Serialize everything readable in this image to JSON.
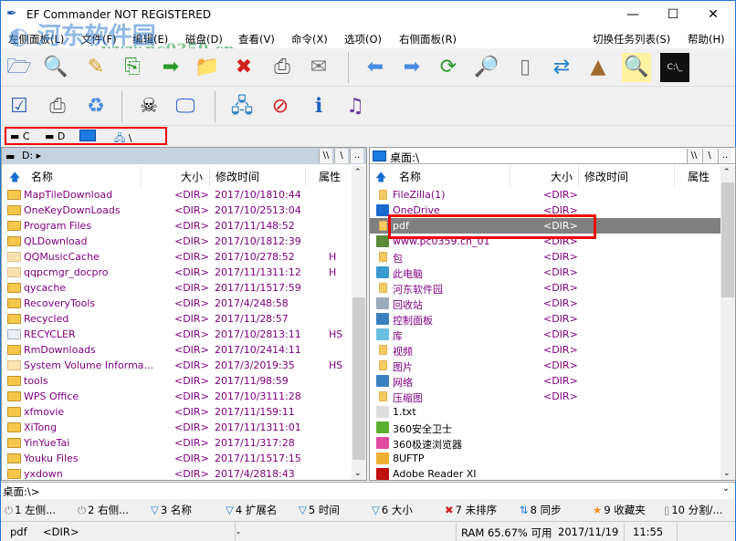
{
  "window": {
    "title": "EF Commander NOT REGISTERED",
    "minimize": "—",
    "maximize": "☐",
    "close": "✕"
  },
  "watermark": {
    "name": "河东软件园",
    "url": "www.pc0359.cn"
  },
  "menu": [
    "左侧面板(L)",
    "文件(F)",
    "编辑(E)",
    "磁盘(D)",
    "查看(V)",
    "命令(X)",
    "选项(O)",
    "右侧面板(R)",
    "切换任务列表(S)",
    "帮助(H)"
  ],
  "drives": {
    "c": "C",
    "d": "D",
    "net": "\\"
  },
  "left": {
    "path": "D: ▸",
    "btns": [
      "\\\\",
      "\\",
      ".."
    ],
    "columns": {
      "name": "名称",
      "size": "大小",
      "date": "修改时间",
      "attr": "属性"
    },
    "rows": [
      {
        "name": "MapTileDownload",
        "size": "<DIR>",
        "date": "2017/10/18",
        "time": "10:44",
        "attr": ""
      },
      {
        "name": "OneKeyDownLoads",
        "size": "<DIR>",
        "date": "2017/10/25",
        "time": "13:04",
        "attr": ""
      },
      {
        "name": "Program Files",
        "size": "<DIR>",
        "date": "2017/11/14",
        "time": "8:52",
        "attr": ""
      },
      {
        "name": "QLDownload",
        "size": "<DIR>",
        "date": "2017/10/18",
        "time": "12:39",
        "attr": ""
      },
      {
        "name": "QQMusicCache",
        "size": "<DIR>",
        "date": "2017/10/27",
        "time": "8:52",
        "attr": "H"
      },
      {
        "name": "qqpcmgr_docpro",
        "size": "<DIR>",
        "date": "2017/11/13",
        "time": "11:12",
        "attr": "H"
      },
      {
        "name": "qycache",
        "size": "<DIR>",
        "date": "2017/11/15",
        "time": "17:59",
        "attr": ""
      },
      {
        "name": "RecoveryTools",
        "size": "<DIR>",
        "date": "2017/4/24",
        "time": "8:58",
        "attr": ""
      },
      {
        "name": "Recycled",
        "size": "<DIR>",
        "date": "2017/11/2",
        "time": "8:57",
        "attr": ""
      },
      {
        "name": "RECYCLER",
        "size": "<DIR>",
        "date": "2017/10/28",
        "time": "13:11",
        "attr": "HS"
      },
      {
        "name": "RmDownloads",
        "size": "<DIR>",
        "date": "2017/10/24",
        "time": "14:11",
        "attr": ""
      },
      {
        "name": "System Volume Informa...",
        "size": "<DIR>",
        "date": "2017/3/20",
        "time": "19:35",
        "attr": "HS"
      },
      {
        "name": "tools",
        "size": "<DIR>",
        "date": "2017/11/9",
        "time": "8:59",
        "attr": ""
      },
      {
        "name": "WPS Office",
        "size": "<DIR>",
        "date": "2017/10/31",
        "time": "11:28",
        "attr": ""
      },
      {
        "name": "xfmovie",
        "size": "<DIR>",
        "date": "2017/11/15",
        "time": "9:11",
        "attr": ""
      },
      {
        "name": "XiTong",
        "size": "<DIR>",
        "date": "2017/11/13",
        "time": "11:01",
        "attr": ""
      },
      {
        "name": "YinYueTai",
        "size": "<DIR>",
        "date": "2017/11/3",
        "time": "17:28",
        "attr": ""
      },
      {
        "name": "Youku Files",
        "size": "<DIR>",
        "date": "2017/11/15",
        "time": "17:15",
        "attr": ""
      },
      {
        "name": "yxdown",
        "size": "<DIR>",
        "date": "2017/4/28",
        "time": "18:43",
        "attr": ""
      }
    ]
  },
  "right": {
    "path": "桌面:\\",
    "btns": [
      "\\\\",
      "\\",
      ".."
    ],
    "columns": {
      "name": "名称",
      "size": "大小",
      "date": "修改时间",
      "attr": "属性"
    },
    "rows": [
      {
        "name": "FileZilla(1)",
        "size": "<DIR>"
      },
      {
        "name": "OneDrive",
        "size": "<DIR>"
      },
      {
        "name": "pdf",
        "size": "<DIR>",
        "selected": true
      },
      {
        "name": "www.pc0359.cn_01",
        "size": "<DIR>"
      },
      {
        "name": "包",
        "size": "<DIR>"
      },
      {
        "name": "此电脑",
        "size": "<DIR>"
      },
      {
        "name": "河东软件园",
        "size": "<DIR>"
      },
      {
        "name": "回收站",
        "size": "<DIR>"
      },
      {
        "name": "控制面板",
        "size": "<DIR>"
      },
      {
        "name": "库",
        "size": "<DIR>"
      },
      {
        "name": "视频",
        "size": "<DIR>"
      },
      {
        "name": "图片",
        "size": "<DIR>"
      },
      {
        "name": "网络",
        "size": "<DIR>"
      },
      {
        "name": "压缩图",
        "size": "<DIR>"
      },
      {
        "name": "1.txt",
        "size": ""
      },
      {
        "name": "360安全卫士",
        "size": ""
      },
      {
        "name": "360极速浏览器",
        "size": ""
      },
      {
        "name": "8UFTP",
        "size": ""
      },
      {
        "name": "Adobe Reader XI",
        "size": ""
      }
    ]
  },
  "cmdline": {
    "prompt": "桌面:\\>"
  },
  "fkeys": [
    "1 左侧...",
    "2 右侧...",
    "3 名称",
    "4 扩展名",
    "5 时间",
    "6 大小",
    "7 未排序",
    "8 同步",
    "9 收藏夹",
    "10 分割/..."
  ],
  "status": {
    "name": "pdf",
    "size": "<DIR>",
    "mid": "-",
    "ram": "RAM 65.67% 可用",
    "date": "2017/11/19",
    "time": "11:55"
  },
  "colors": {
    "dir": "#800080",
    "selection": "#808080",
    "highlight": "#e00000",
    "panelHeader": "#c5d2df"
  }
}
